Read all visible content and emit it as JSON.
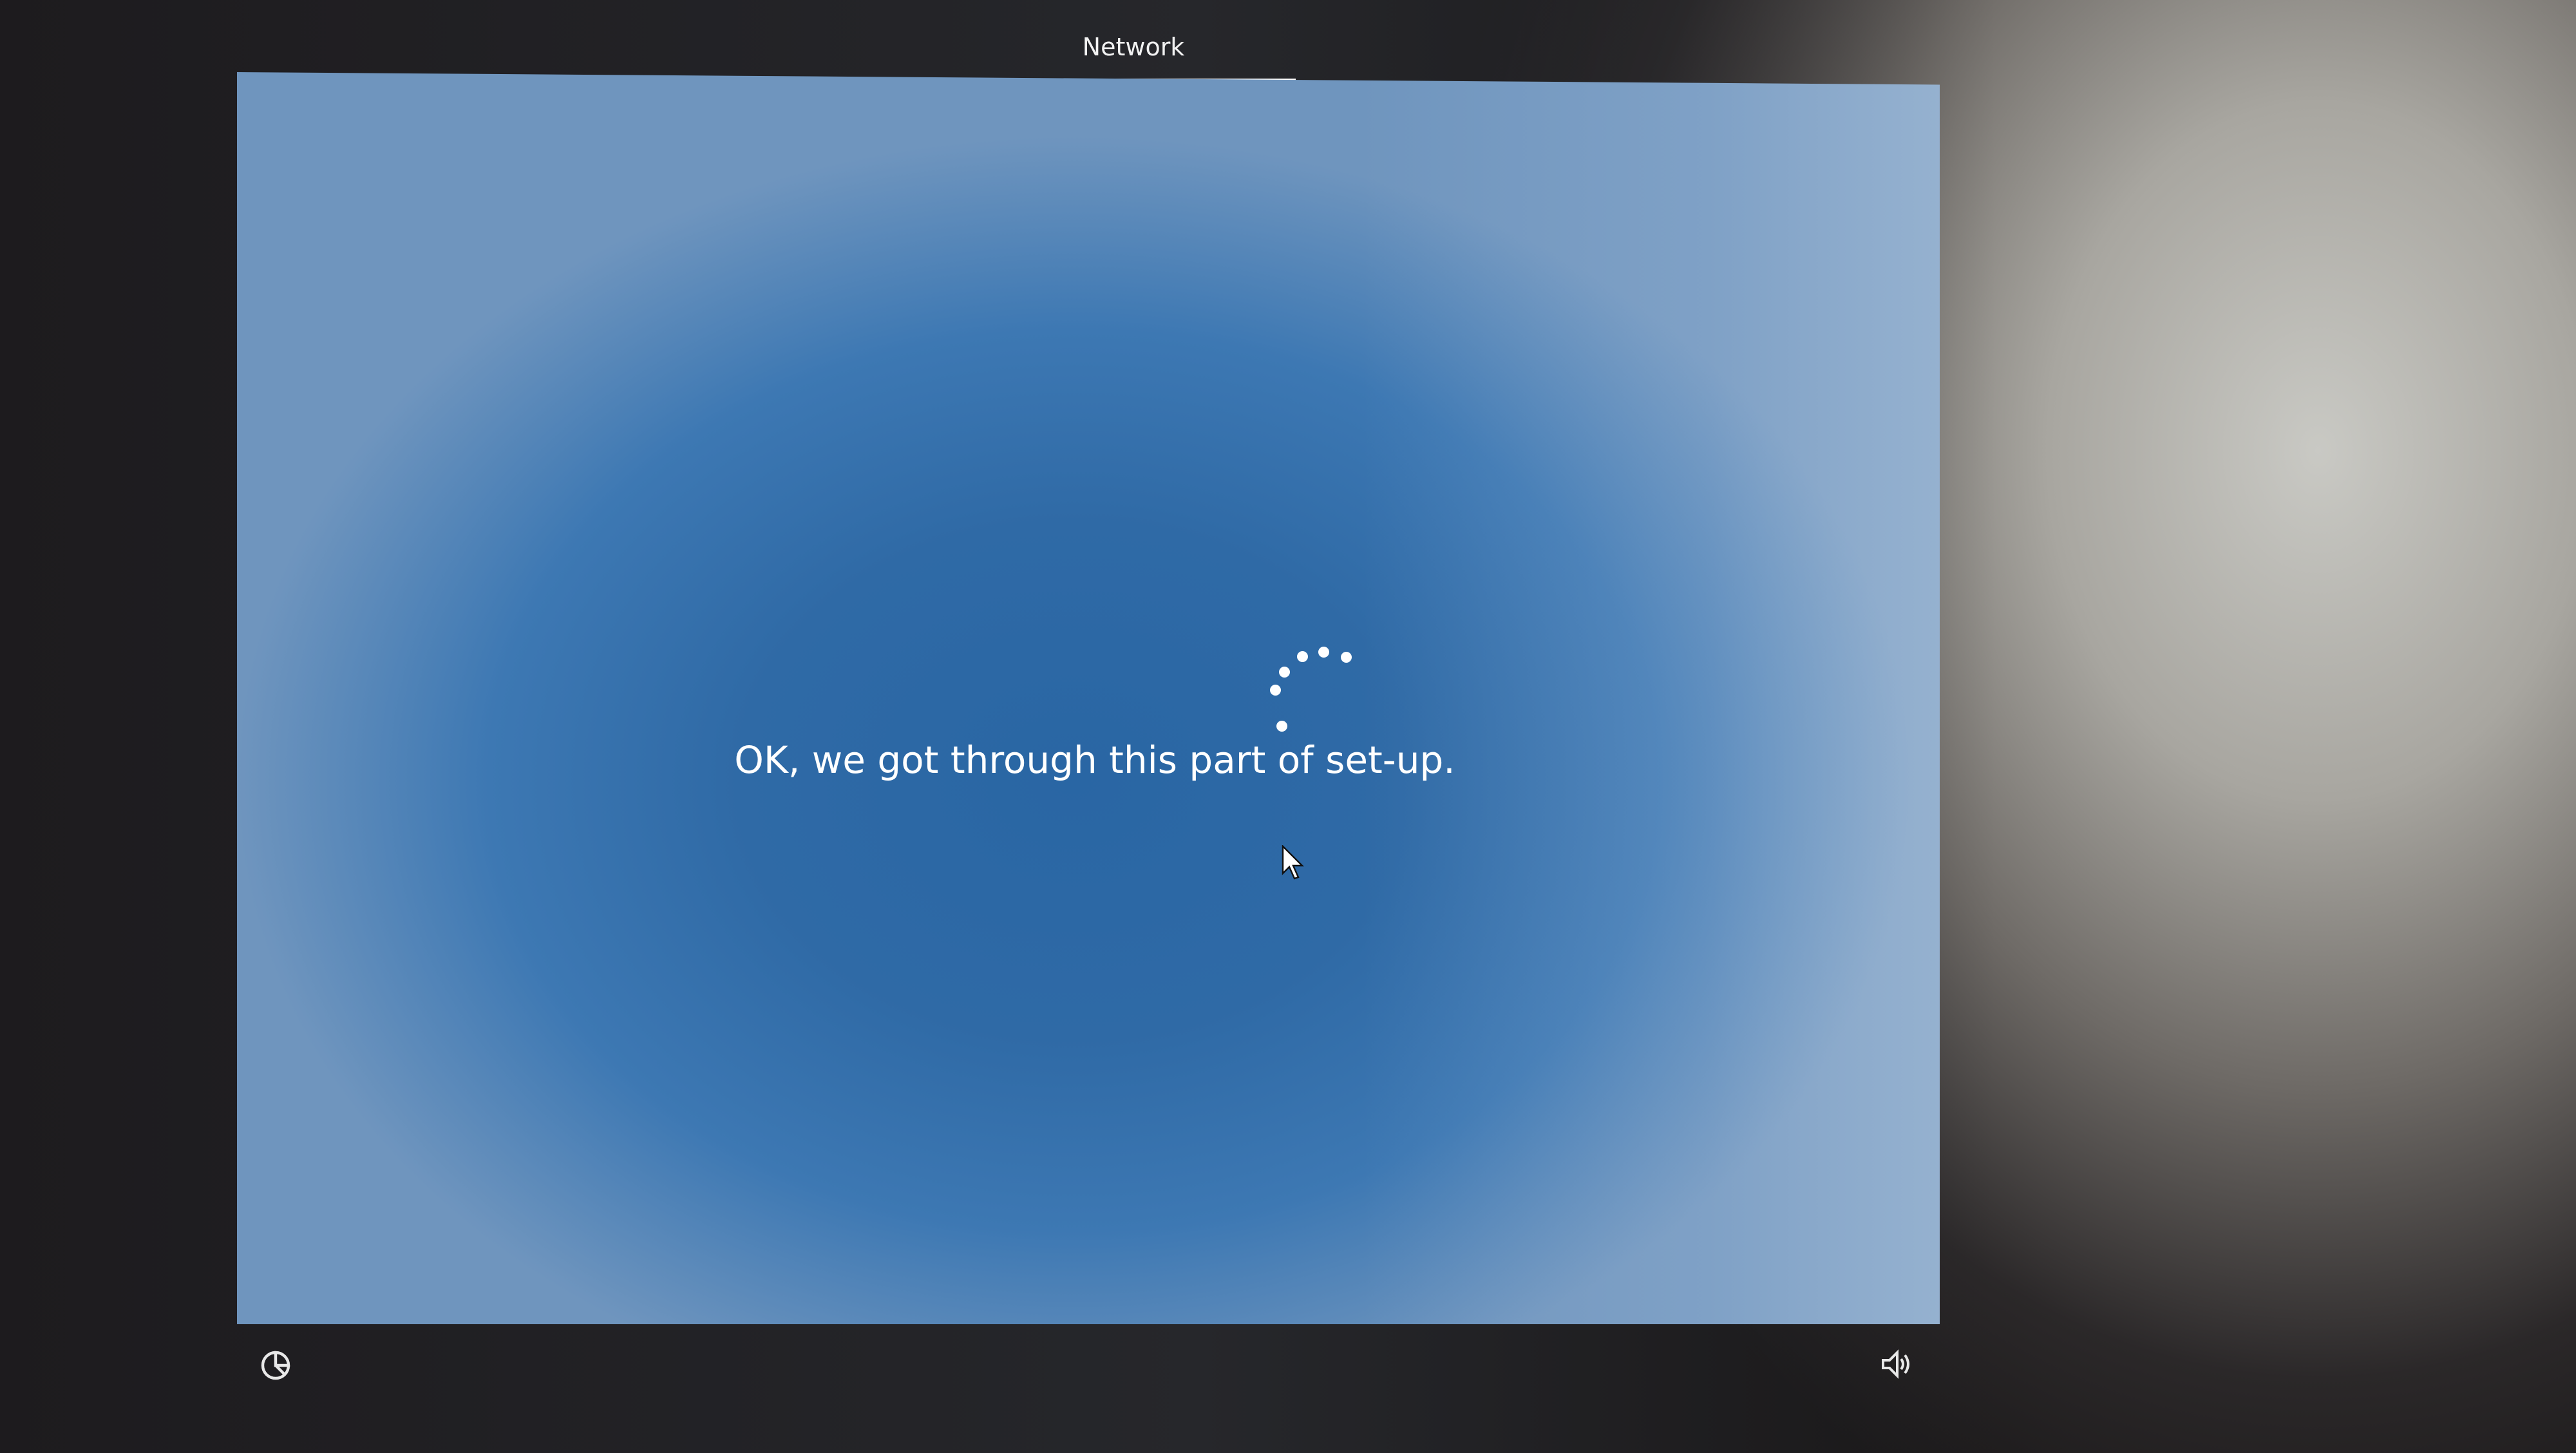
{
  "header": {
    "title": "Network"
  },
  "main": {
    "message": "OK, we got through this part of set-up."
  },
  "footer": {
    "left_icon": "ease-of-access-icon",
    "right_icon": "volume-icon"
  },
  "colors": {
    "screen_blue": "#2f6aa6",
    "text": "#ffffff"
  }
}
